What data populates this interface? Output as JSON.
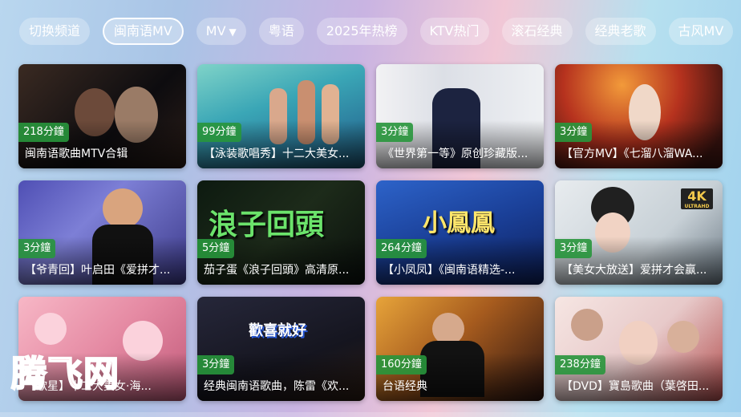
{
  "categories": [
    {
      "label": "切换频道"
    },
    {
      "label": "闽南语MV",
      "active": true
    },
    {
      "label": "MV",
      "has_dropdown": true
    },
    {
      "label": "粤语"
    },
    {
      "label": "2025年热榜"
    },
    {
      "label": "KTV热门"
    },
    {
      "label": "滚石经典"
    },
    {
      "label": "经典老歌"
    },
    {
      "label": "古风MV"
    }
  ],
  "videos": [
    {
      "duration": "218分鐘",
      "title": "闽南语歌曲MTV合辑"
    },
    {
      "duration": "99分鐘",
      "title": "【泳装歌唱秀】十二大美女..."
    },
    {
      "duration": "3分鐘",
      "title": "《世界第一等》原创珍藏版..."
    },
    {
      "duration": "3分鐘",
      "title": "【官方MV】《七溜八溜WA..."
    },
    {
      "duration": "3分鐘",
      "title": "【爷青回】叶启田《爱拼才..."
    },
    {
      "duration": "5分鐘",
      "title": "茄子蛋《浪子回頭》高清原..."
    },
    {
      "duration": "264分鐘",
      "title": "【小凤凤】《闽南语精选-..."
    },
    {
      "duration": "3分鐘",
      "title": "【美女大放送】爱拼才会赢..."
    },
    {
      "duration": "",
      "title": "【歌星】十二大美女·海..."
    },
    {
      "duration": "3分鐘",
      "title": "经典闽南语歌曲，陈雷《欢..."
    },
    {
      "duration": "160分鐘",
      "title": "台语经典"
    },
    {
      "duration": "238分鐘",
      "title": "【DVD】寶島歌曲（葉啓田..."
    }
  ],
  "thumb_text": {
    "card5": "浪子回頭",
    "card6": "小鳳鳳",
    "card9": "歡喜就好",
    "badge": "4K",
    "badge_sub": "ULTRAHD"
  },
  "watermark": "腾飞网",
  "colors": {
    "duration_badge": "#2f9a3f",
    "watermark": "#e6192e"
  }
}
